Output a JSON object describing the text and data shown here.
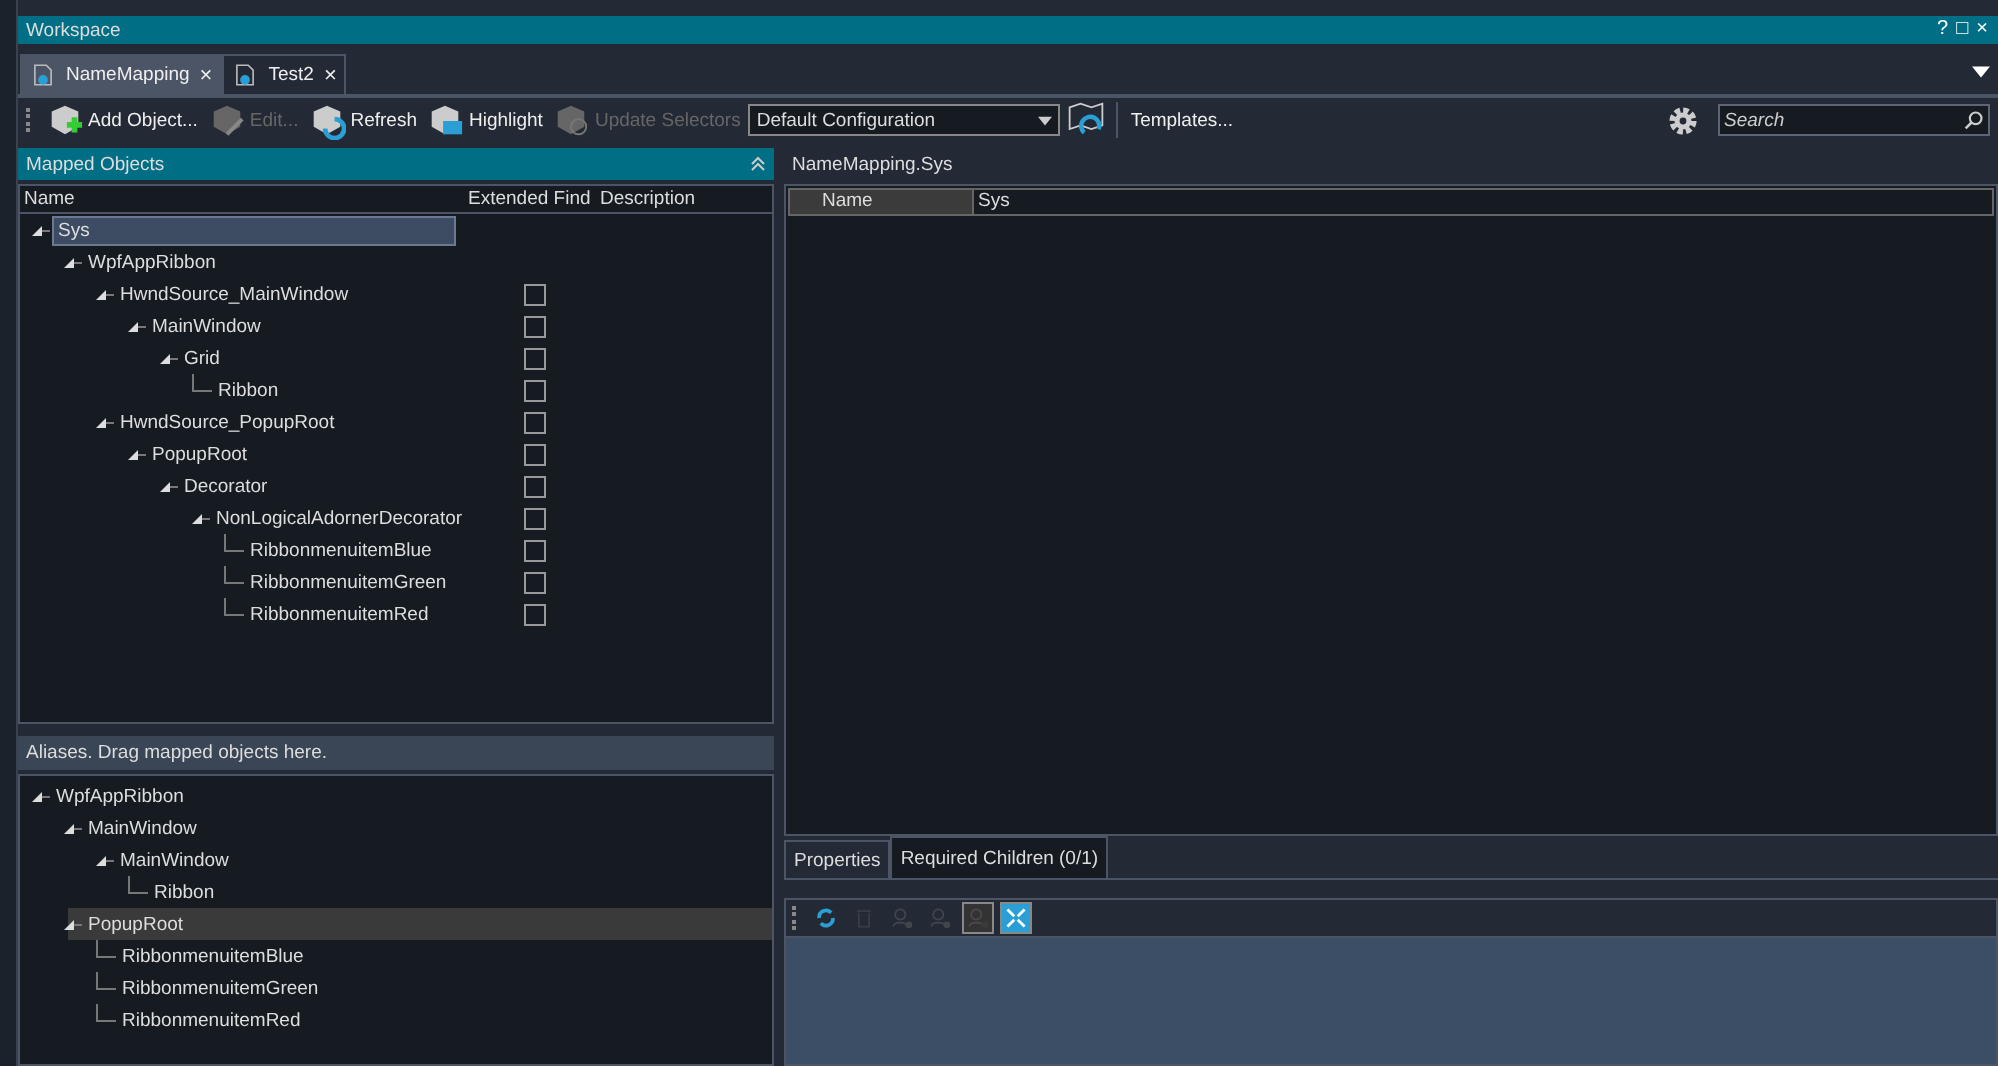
{
  "window": {
    "title": "Workspace",
    "controls": [
      "?",
      "□",
      "×"
    ]
  },
  "tabs": [
    {
      "label": "NameMapping",
      "selected": true,
      "close": "×"
    },
    {
      "label": "Test2",
      "selected": false,
      "close": "×"
    }
  ],
  "toolbar": {
    "buttons": [
      {
        "label": "Add Object...",
        "disabled": false,
        "kind": "add"
      },
      {
        "label": "Edit...",
        "disabled": true,
        "kind": "edit"
      },
      {
        "label": "Refresh",
        "disabled": false,
        "kind": "refresh"
      },
      {
        "label": "Highlight",
        "disabled": false,
        "kind": "highlight"
      },
      {
        "label": "Update Selectors",
        "disabled": true,
        "kind": "update"
      }
    ],
    "configuration": "Default Configuration",
    "templates": "Templates...",
    "search": {
      "placeholder": "Search"
    }
  },
  "mapped_objects": {
    "title": "Mapped Objects",
    "columns": [
      "Name",
      "Extended Find",
      "Description"
    ],
    "tree": [
      {
        "name": "Sys",
        "selected": true,
        "children": [
          {
            "name": "WpfAppRibbon",
            "selected": false,
            "children": [
              {
                "name": "HwndSource_MainWindow",
                "selected": false,
                "checked": false,
                "children": [
                  {
                    "name": "MainWindow",
                    "selected": false,
                    "checked": false,
                    "children": [
                      {
                        "name": "Grid",
                        "selected": false,
                        "checked": false,
                        "children": [
                          {
                            "name": "Ribbon",
                            "selected": false,
                            "checked": false
                          }
                        ]
                      }
                    ]
                  }
                ]
              },
              {
                "name": "HwndSource_PopupRoot",
                "selected": false,
                "checked": false,
                "children": [
                  {
                    "name": "PopupRoot",
                    "selected": false,
                    "checked": false,
                    "children": [
                      {
                        "name": "Decorator",
                        "selected": false,
                        "checked": false,
                        "children": [
                          {
                            "name": "NonLogicalAdornerDecorator",
                            "selected": false,
                            "checked": false,
                            "children": [
                              {
                                "name": "RibbonmenuitemBlue",
                                "selected": false,
                                "checked": false
                              },
                              {
                                "name": "RibbonmenuitemGreen",
                                "selected": false,
                                "checked": false
                              },
                              {
                                "name": "RibbonmenuitemRed",
                                "selected": false,
                                "checked": false
                              }
                            ]
                          }
                        ]
                      }
                    ]
                  }
                ]
              }
            ]
          }
        ]
      }
    ]
  },
  "aliases": {
    "title": "Aliases. Drag mapped objects here.",
    "tree": [
      {
        "name": "WpfAppRibbon",
        "selected": false,
        "children": [
          {
            "name": "MainWindow",
            "selected": false,
            "children": [
              {
                "name": "MainWindow",
                "selected": false,
                "children": [
                  {
                    "name": "Ribbon",
                    "selected": false
                  }
                ]
              }
            ]
          },
          {
            "name": "PopupRoot",
            "selected": true,
            "children": [
              {
                "name": "RibbonmenuitemBlue",
                "selected": false
              },
              {
                "name": "RibbonmenuitemGreen",
                "selected": false
              },
              {
                "name": "RibbonmenuitemRed",
                "selected": false
              }
            ]
          }
        ]
      }
    ]
  },
  "details": {
    "title": "NameMapping.Sys",
    "properties": [
      {
        "name": "Name",
        "value": "Sys"
      }
    ],
    "tabs": [
      {
        "label": "Properties",
        "selected": false
      },
      {
        "label": "Required Children (0/1)",
        "selected": true
      }
    ],
    "tools": [
      {
        "kind": "refresh",
        "disabled": false,
        "pressed": false
      },
      {
        "kind": "delete",
        "disabled": true,
        "pressed": false
      },
      {
        "kind": "add",
        "disabled": true,
        "pressed": false
      },
      {
        "kind": "remove",
        "disabled": true,
        "pressed": false
      },
      {
        "kind": "clear",
        "disabled": true,
        "pressed": true
      },
      {
        "kind": "expand",
        "disabled": false,
        "pressed": true
      }
    ]
  }
}
